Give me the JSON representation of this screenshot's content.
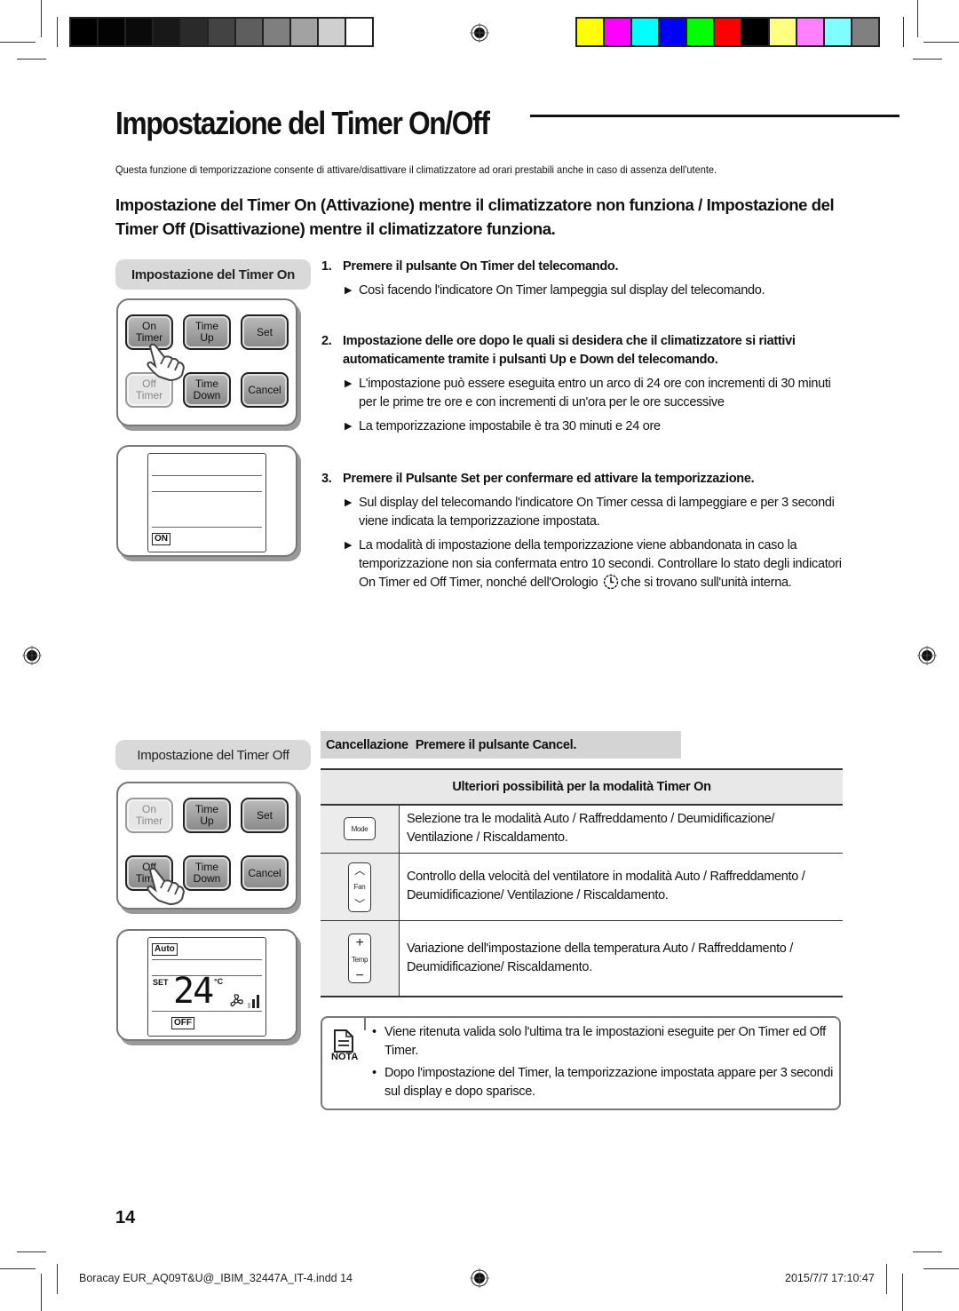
{
  "print_marks": {
    "grayscale_swatches": [
      "#000000",
      "#030303",
      "#0a0a0a",
      "#181818",
      "#2a2a2a",
      "#434343",
      "#5e5e5e",
      "#7f7f7f",
      "#a2a2a2",
      "#cfcfcf",
      "#ffffff"
    ],
    "color_swatches": [
      "#ffff00",
      "#ff00ff",
      "#00ffff",
      "#0000ff",
      "#00ff00",
      "#ff0000",
      "#000000",
      "#ffff80",
      "#ff80ff",
      "#80ffff",
      "#808080"
    ]
  },
  "page": {
    "title": "Impostazione del Timer On/Off",
    "intro": "Questa funzione di temporizzazione consente di attivare/disattivare il climatizzatore ad orari prestabili anche in caso di assenza dell'utente.",
    "subheading": "Impostazione del Timer On (Attivazione) mentre il climatizzatore non funziona / Impostazione del Timer Off (Disattivazione) mentre il climatizzatore  funziona."
  },
  "timer_on_section": {
    "label": "Impostazione del Timer On",
    "buttons": {
      "on_timer": [
        "On",
        "Timer"
      ],
      "time_up": [
        "Time",
        "Up"
      ],
      "set": "Set",
      "off_timer": [
        "Off",
        "Timer"
      ],
      "time_down": [
        "Time",
        "Down"
      ],
      "cancel": "Cancel"
    },
    "display": {
      "indicator": "ON"
    }
  },
  "steps": [
    {
      "number": "1.",
      "title": "Premere il pulsante On Timer del telecomando.",
      "bullets": [
        "Così facendo l'indicatore On Timer  lampeggia sul display del telecomando."
      ]
    },
    {
      "number": "2.",
      "title": "Impostazione delle ore dopo le quali  si desidera che il climatizzatore si riattivi automaticamente tramite i pulsanti Up e Down del telecomando.",
      "bullets": [
        "L'impostazione può essere eseguita entro un arco di 24 ore con incrementi di 30 minuti per le prime tre ore e con incrementi di un'ora per le ore successive",
        "La temporizzazione impostabile è tra 30 minuti e 24 ore"
      ]
    },
    {
      "number": "3.",
      "title": "Premere il Pulsante Set per confermare ed attivare  la temporizzazione.",
      "bullets": [
        "Sul display del telecomando l'indicatore On Timer cessa di lampeggiare e per 3 secondi viene indicata la temporizzazione impostata.",
        "La modalità di impostazione della temporizzazione viene abbandonata in caso la temporizzazione non sia confermata entro 10 secondi.  Controllare lo stato degli indicatori On Timer ed Off Timer, nonché dell'Orologio",
        "che si trovano sull'unità interna."
      ]
    }
  ],
  "timer_off_section": {
    "label": "Impostazione del Timer Off",
    "display": {
      "mode": "Auto",
      "set_label": "SET",
      "temperature": "24",
      "unit": "°C",
      "indicator": "OFF"
    }
  },
  "cancel": {
    "label": "Cancellazione",
    "text": "Premere il pulsante Cancel."
  },
  "options_table": {
    "header": "Ulteriori possibilità  per la modalità Timer On",
    "rows": [
      {
        "icon": "mode-button",
        "icon_label": "Mode",
        "text": "Selezione tra le modalità Auto / Raffreddamento / Deumidificazione/ Ventilazione  / Riscaldamento."
      },
      {
        "icon": "fan-button",
        "icon_label": "Fan",
        "text": "Controllo della velocità del ventilatore in  modalità Auto / Raffreddamento / Deumidificazione/ Ventilazione  / Riscaldamento."
      },
      {
        "icon": "temp-button",
        "icon_label": "Temp",
        "text": "Variazione dell'impostazione della temperatura Auto / Raffreddamento / Deumidificazione/ Riscaldamento."
      }
    ]
  },
  "note": {
    "label": "NOTA",
    "items": [
      "Viene ritenuta valida solo  l'ultima tra le impostazioni eseguite per  On Timer ed Off Timer.",
      "Dopo l'impostazione del Timer, la temporizzazione impostata appare per 3 secondi sul display e dopo sparisce."
    ]
  },
  "footer": {
    "page_number": "14",
    "slug_file": "Boracay EUR_AQ09T&U@_IBIM_32447A_IT-4.indd   14",
    "slug_date": "2015/7/7   17:10:47"
  }
}
